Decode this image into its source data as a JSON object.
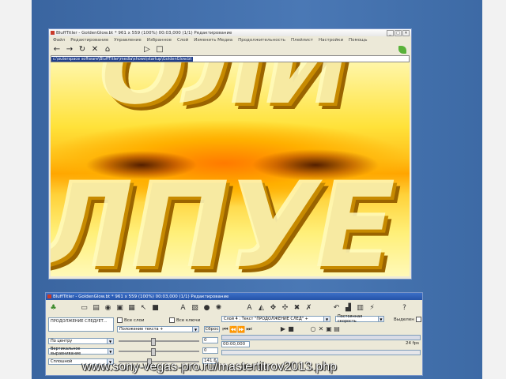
{
  "window1": {
    "title": "BluffTitler - GoldenGlow.bt * 961 x 559 (100%) 00:03,000 (1/1) Редактирование",
    "controls": [
      "_",
      "□",
      "✕"
    ],
    "menu": [
      "Файл",
      "Редактирование",
      "Управление",
      "Избранное",
      "Слой",
      "Изменить Медиа",
      "Продолжительность",
      "Плейлист",
      "Настройки",
      "Помощь"
    ],
    "url": "c:\\outerspace software\\BluffTitler\\media\\shows\\startup\\GoldenGlow.bt",
    "preview_text_top": "ОЛИ",
    "preview_text_bottom": "ЛПУЕ"
  },
  "window2": {
    "title": "BluffTitler - GoldenGlow.bt * 961 x 559 (100%) 00:03,000 (1/1) Редактирование",
    "text_value": "ПРОДОЛЖЕНИЕ СЛЕДУЕТ...",
    "all_layers": "Все слои",
    "all_keys": "Все ключи",
    "position_select": "Положение текста +",
    "reset_button": "Сброс",
    "layer_select": "Слой 4 : Текст \"ПРОДОЛЖЕНИЕ СЛЕД\" +",
    "speed_select": "Постоянная скорость",
    "selected_label": "Выделен",
    "align_h": "По центру",
    "align_v": "Вертикальное выравнивание",
    "fill": "Сплошной",
    "value1": "0",
    "value2": "0",
    "value3": "141.6",
    "time": "00:00,000",
    "fps": "24 fps",
    "slider_levels": [
      0.4,
      0.4,
      0.35
    ]
  },
  "watermark": "www.sony-vegas-pro.ru/mastertitrov2013.php"
}
